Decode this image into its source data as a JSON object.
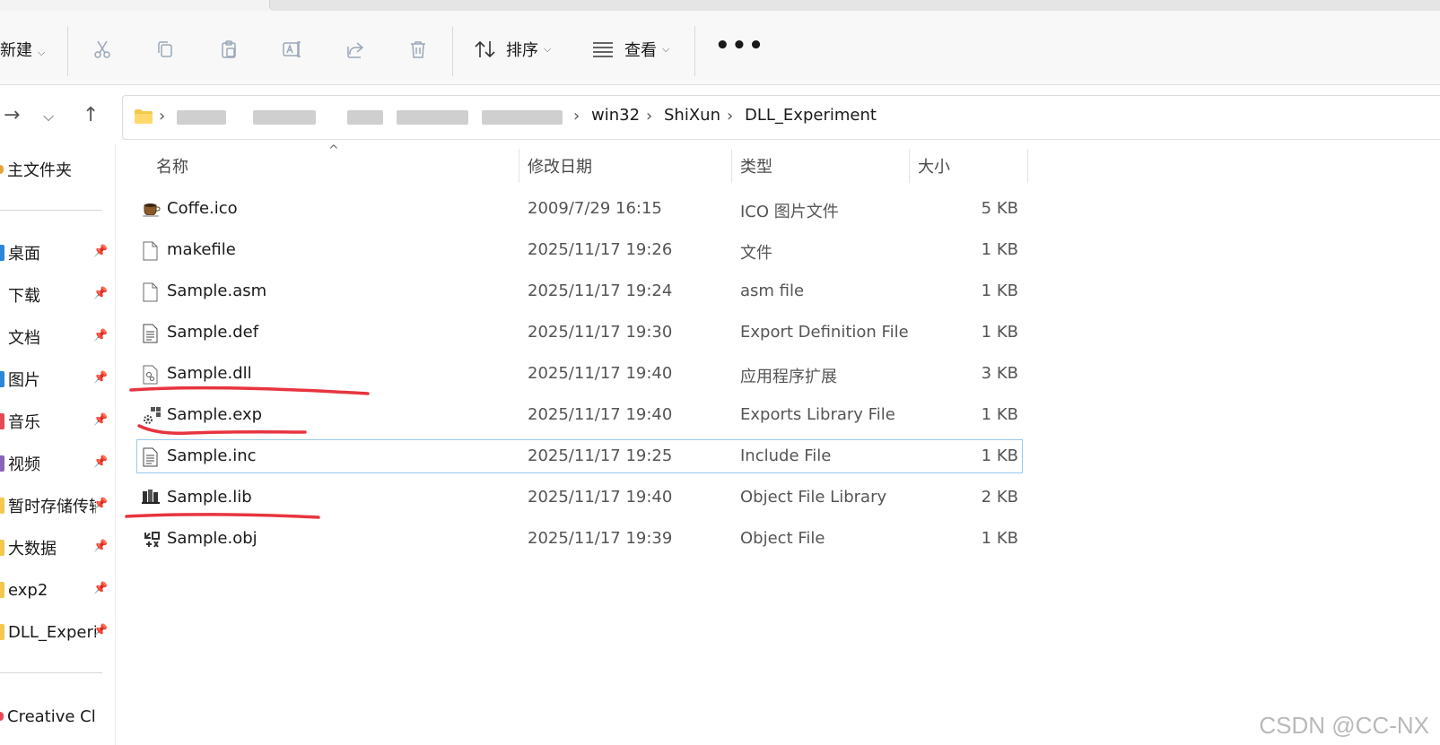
{
  "toolbar": {
    "new_label": "新建",
    "sort_label": "排序",
    "view_label": "查看",
    "more_label": "•••",
    "icons": [
      "cut-icon",
      "copy-icon",
      "paste-icon",
      "rename-icon",
      "share-icon",
      "delete-icon"
    ]
  },
  "address": {
    "crumbs": [
      "win32",
      "ShiXun",
      "DLL_Experiment"
    ]
  },
  "nav": {
    "home": "主文件夹",
    "quick": [
      {
        "label": "桌面",
        "color": "#2b88d8"
      },
      {
        "label": "下载",
        "color": "#ffffff"
      },
      {
        "label": "文档",
        "color": "#ffffff"
      },
      {
        "label": "图片",
        "color": "#2b88d8"
      },
      {
        "label": "音乐",
        "color": "#e74856"
      },
      {
        "label": "视频",
        "color": "#8764b8"
      },
      {
        "label": "暂时存储传输",
        "color": "#f2c94c"
      },
      {
        "label": "大数据",
        "color": "#f2c94c"
      },
      {
        "label": "exp2",
        "color": "#f2c94c"
      },
      {
        "label": "DLL_Experiment",
        "color": "#f2c94c"
      }
    ],
    "creative": "Creative Cloud"
  },
  "columns": {
    "name": "名称",
    "date": "修改日期",
    "type": "类型",
    "size": "大小"
  },
  "files": [
    {
      "name": "Coffe.ico",
      "date": "2009/7/29 16:15",
      "type": "ICO 图片文件",
      "size": "5 KB",
      "icon": "coffee-icon"
    },
    {
      "name": "makefile",
      "date": "2025/11/17 19:26",
      "type": "文件",
      "size": "1 KB",
      "icon": "blank-file-icon"
    },
    {
      "name": "Sample.asm",
      "date": "2025/11/17 19:24",
      "type": "asm file",
      "size": "1 KB",
      "icon": "blank-file-icon"
    },
    {
      "name": "Sample.def",
      "date": "2025/11/17 19:30",
      "type": "Export Definition File",
      "size": "1 KB",
      "icon": "text-file-icon"
    },
    {
      "name": "Sample.dll",
      "date": "2025/11/17 19:40",
      "type": "应用程序扩展",
      "size": "3 KB",
      "icon": "dll-file-icon"
    },
    {
      "name": "Sample.exp",
      "date": "2025/11/17 19:40",
      "type": "Exports Library File",
      "size": "1 KB",
      "icon": "gear-file-icon"
    },
    {
      "name": "Sample.inc",
      "date": "2025/11/17 19:25",
      "type": "Include File",
      "size": "1 KB",
      "icon": "text-file-icon"
    },
    {
      "name": "Sample.lib",
      "date": "2025/11/17 19:40",
      "type": "Object File Library",
      "size": "2 KB",
      "icon": "library-icon"
    },
    {
      "name": "Sample.obj",
      "date": "2025/11/17 19:39",
      "type": "Object File",
      "size": "1 KB",
      "icon": "object-file-icon"
    }
  ],
  "selected_index": 6,
  "colors": {
    "selection_border": "#99c9ef",
    "annotation_red": "#e8343f",
    "folder": "#f2c94c"
  },
  "watermark": "CSDN @CC-NX"
}
